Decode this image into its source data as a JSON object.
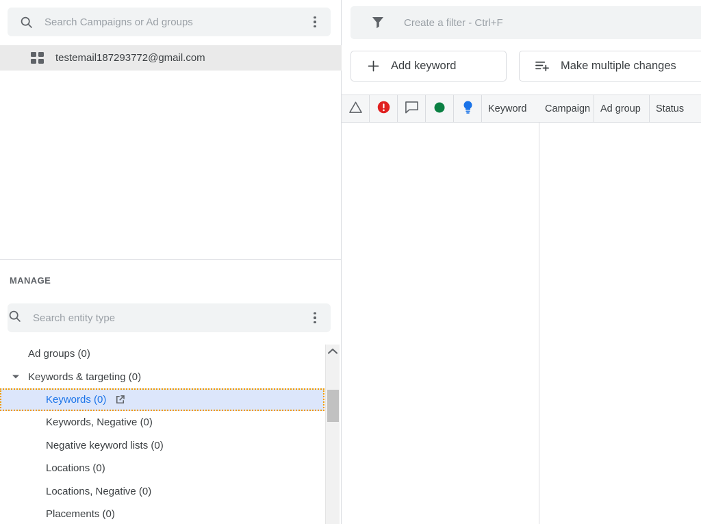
{
  "sidebar": {
    "search": {
      "placeholder": "Search Campaigns or Ad groups",
      "value": "",
      "icon": "search-icon",
      "overflow_icon": "kebab-menu-icon"
    },
    "account": {
      "label": "testemail187293772@gmail.com",
      "icon": "grid-icon",
      "selected": true
    },
    "manage_title": "MANAGE",
    "entity_search": {
      "placeholder": "Search entity type",
      "value": "",
      "icon": "search-icon",
      "overflow_icon": "kebab-menu-icon"
    },
    "tree": [
      {
        "label": "Ad groups (0)",
        "level": 1,
        "selected": false,
        "expandable": false
      },
      {
        "label": "Keywords & targeting (0)",
        "level": 1,
        "selected": false,
        "expandable": true
      },
      {
        "label": "Keywords (0)",
        "level": 2,
        "selected": true,
        "expandable": false,
        "external_link": true
      },
      {
        "label": "Keywords, Negative (0)",
        "level": 2,
        "selected": false,
        "expandable": false
      },
      {
        "label": "Negative keyword lists (0)",
        "level": 2,
        "selected": false,
        "expandable": false
      },
      {
        "label": "Locations (0)",
        "level": 2,
        "selected": false,
        "expandable": false
      },
      {
        "label": "Locations, Negative (0)",
        "level": 2,
        "selected": false,
        "expandable": false
      },
      {
        "label": "Placements (0)",
        "level": 2,
        "selected": false,
        "expandable": false
      }
    ],
    "scrollbar": {
      "up_icon": "chevron-up-icon"
    }
  },
  "main": {
    "filter": {
      "placeholder": "Create a filter - Ctrl+F",
      "value": "",
      "icon": "filter-funnel-icon"
    },
    "buttons": [
      {
        "label": "Add keyword",
        "icon": "plus-icon"
      },
      {
        "label": "Make multiple changes",
        "icon": "list-plus-icon"
      }
    ],
    "table": {
      "icon_columns": [
        {
          "name": "warning-triangle-icon",
          "color": "#5f6368"
        },
        {
          "name": "error-circle-icon",
          "color": "#e02020"
        },
        {
          "name": "comment-bubble-icon",
          "color": "#5f6368"
        },
        {
          "name": "green-circle-icon",
          "color": "#0b8043"
        },
        {
          "name": "lightbulb-icon",
          "color": "#1a73e8"
        }
      ],
      "columns": [
        "Keyword",
        "Campaign",
        "Ad group",
        "Status"
      ],
      "rows": []
    }
  },
  "colors": {
    "accent_blue": "#1a73e8",
    "focus_orange": "#f29900",
    "selection_blue": "#dce6fb",
    "error_red": "#e02020",
    "success_green": "#0b8043",
    "border_gray": "#dadce0",
    "field_gray": "#f1f3f4"
  }
}
